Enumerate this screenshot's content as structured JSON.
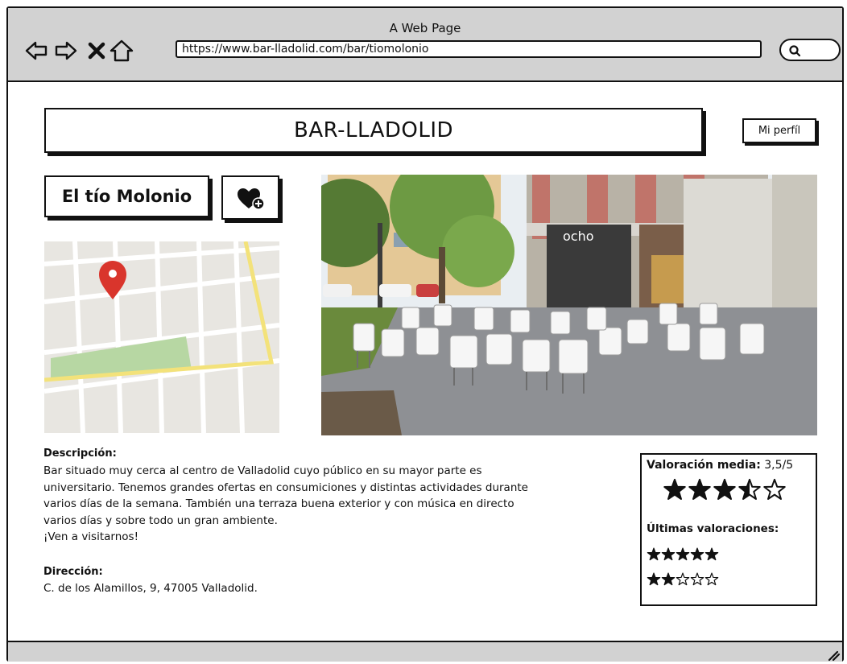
{
  "browser": {
    "window_title": "A Web Page",
    "url": "https://www.bar-lladolid.com/bar/tiomolonio",
    "nav_icons": [
      "back-arrow-icon",
      "forward-arrow-icon",
      "close-icon",
      "home-icon"
    ],
    "search_icon": "search-icon"
  },
  "header": {
    "site_title": "BAR-LLADOLID",
    "profile_label": "Mi perfíl"
  },
  "bar": {
    "name": "El tío Molonio",
    "favorite_icon": "heart-add-icon"
  },
  "map": {
    "marker_icon": "map-pin-icon",
    "pin_color": "#d9352c",
    "road_color": "#f3e27a",
    "park_color": "#b7d7a3"
  },
  "photo": {
    "sign_text": "ocho"
  },
  "description": {
    "heading": "Descripción:",
    "lines": [
      "Bar situado muy cerca al centro de Valladolid cuyo público en su mayor parte es",
      "universitario. Tenemos grandes ofertas en consumiciones y distintas actividades durante",
      "varios días de la semana. También una terraza buena exterior y con música en directo",
      "varios días y sobre todo un gran ambiente.",
      "¡Ven a visitarnos!"
    ]
  },
  "address": {
    "heading": "Dirección:",
    "value": "C. de los Alamillos, 9, 47005 Valladolid."
  },
  "rating": {
    "label": "Valoración media:",
    "value_text": " 3,5/5",
    "average": 3.5,
    "max": 5,
    "latest_heading": "Últimas valoraciones:",
    "latest": [
      5,
      2
    ]
  }
}
